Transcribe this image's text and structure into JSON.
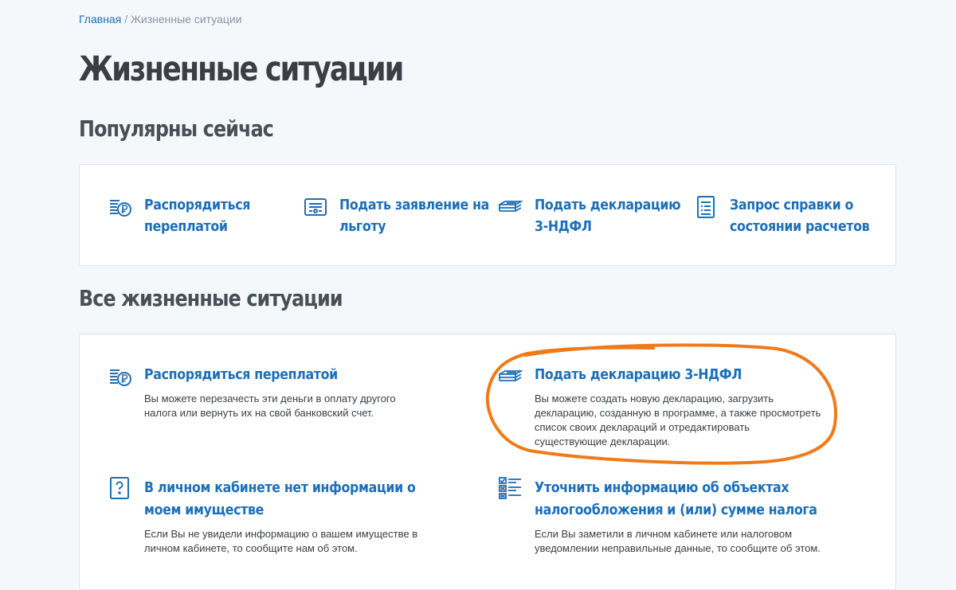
{
  "breadcrumb": {
    "home": "Главная",
    "separator": "/",
    "current": "Жизненные ситуации"
  },
  "page_title": "Жизненные ситуации",
  "popular": {
    "heading": "Популярны сейчас",
    "items": [
      {
        "label": "Распорядиться переплатой",
        "icon": "ruble-coins-icon"
      },
      {
        "label": "Подать заявление на льготу",
        "icon": "certificate-icon"
      },
      {
        "label": "Подать декларацию 3-НДФЛ",
        "icon": "declaration-stack-icon"
      },
      {
        "label": "Запрос справки о состоянии расчетов",
        "icon": "document-list-icon"
      }
    ]
  },
  "all": {
    "heading": "Все жизненные ситуации",
    "items": [
      {
        "title": "Распорядиться переплатой",
        "description": "Вы можете перезачесть эти деньги в оплату другого налога или вернуть их на свой банковский счет.",
        "icon": "ruble-coins-icon"
      },
      {
        "title": "Подать декларацию 3-НДФЛ",
        "description": "Вы можете создать новую декларацию, загрузить декларацию, созданную в программе, а также просмотреть список своих деклараций и отредактировать существующие декларации.",
        "icon": "declaration-stack-icon"
      },
      {
        "title": "В личном кабинете нет информации о моем имуществе",
        "description": "Если Вы не увидели информацию о вашем имуществе в личном кабинете, то сообщите нам об этом.",
        "icon": "question-box-icon"
      },
      {
        "title": "Уточнить информацию об объектах налогообложения и (или) сумме налога",
        "description": "Если Вы заметили в личном кабинете или налоговом уведомлении неправильные данные, то сообщите об этом.",
        "icon": "checklist-icon"
      }
    ]
  },
  "colors": {
    "link": "#1d6fb8",
    "highlight": "#f07a1a",
    "background": "#f4f8fb"
  }
}
